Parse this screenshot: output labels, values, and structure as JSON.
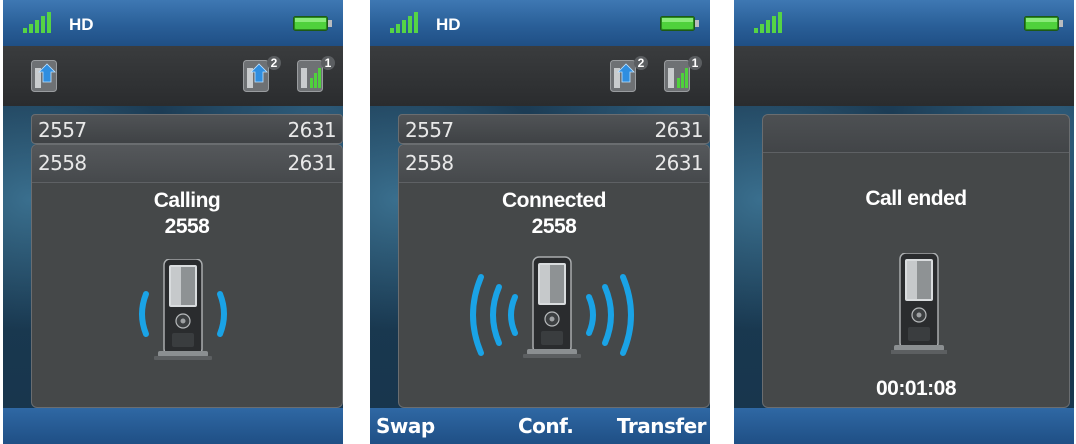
{
  "screens": [
    {
      "status_bar": {
        "hd_label": "HD",
        "signal_icon": "signal-strength-icon",
        "battery_icon": "battery-full-icon"
      },
      "action_bar": {
        "lines": [
          {
            "icon": "line-arrow-icon"
          },
          {
            "icon": "line-arrow-icon",
            "badge": "2"
          },
          {
            "icon": "line-signal-icon",
            "badge": "1"
          }
        ]
      },
      "calls": [
        {
          "number": "2557",
          "line": "2631"
        },
        {
          "number": "2558",
          "line": "2631"
        }
      ],
      "call_status": "Calling",
      "call_number": "2558",
      "handset_icon": "handset-ringing-icon",
      "softkeys": []
    },
    {
      "status_bar": {
        "hd_label": "HD",
        "signal_icon": "signal-strength-icon",
        "battery_icon": "battery-full-icon"
      },
      "action_bar": {
        "lines": [
          {
            "icon": "line-arrow-icon",
            "badge": "2"
          },
          {
            "icon": "line-signal-icon",
            "badge": "1"
          }
        ]
      },
      "calls": [
        {
          "number": "2557",
          "line": "2631"
        },
        {
          "number": "2558",
          "line": "2631"
        }
      ],
      "call_status": "Connected",
      "call_number": "2558",
      "handset_icon": "handset-connected-icon",
      "softkeys": [
        "Swap",
        "Conf.",
        "Transfer"
      ]
    },
    {
      "status_bar": {
        "signal_icon": "signal-strength-icon",
        "battery_icon": "battery-full-icon"
      },
      "call_status": "Call ended",
      "call_duration": "00:01:08",
      "handset_icon": "handset-icon",
      "softkeys": []
    }
  ],
  "colors": {
    "status_bar": "#2a5f98",
    "action_bar": "#2f3133",
    "panel": "#454849",
    "wave": "#1aa3e6",
    "battery": "#3bbf2a"
  }
}
